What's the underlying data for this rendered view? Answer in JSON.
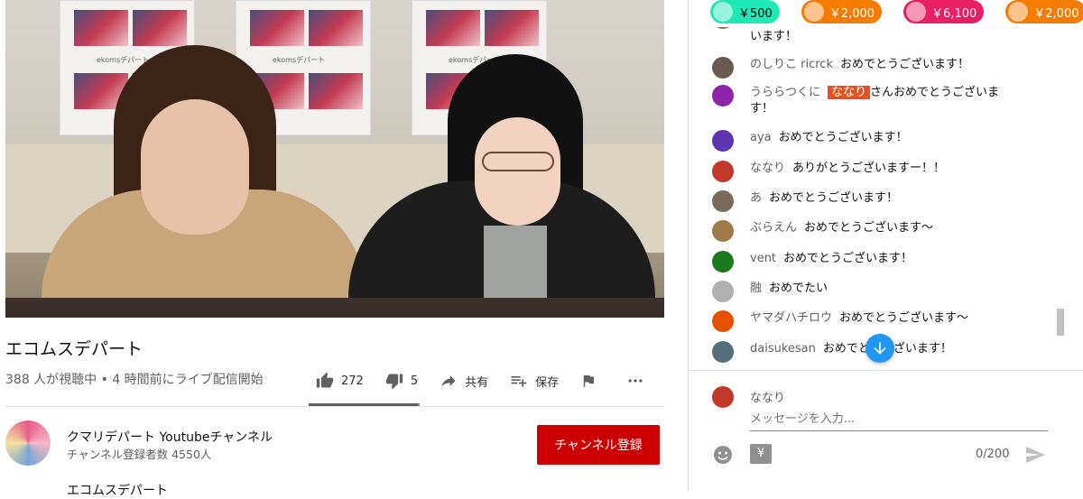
{
  "video": {
    "title": "エコムスデパート",
    "meta": "388 人が視聴中 • 4 時間前にライブ配信開始",
    "poster_brand": "ekomsデパート",
    "actions": {
      "likes": "272",
      "dislikes": "5",
      "share": "共有",
      "save": "保存"
    },
    "like_ratio": 0.98
  },
  "channel": {
    "name": "クマリデパート Youtubeチャンネル",
    "subscribers": "チャンネル登録者数 4550人",
    "subscribe_label": "チャンネル登録",
    "description_start": "エコムスデパート"
  },
  "chat": {
    "tickers": [
      {
        "amount": "￥500",
        "color": "#1de9b6",
        "text_color": "#000000"
      },
      {
        "amount": "￥2,000",
        "color": "#f57c00",
        "text_color": "#ffffff"
      },
      {
        "amount": "￥6,100",
        "color": "#e91e63",
        "text_color": "#ffffff"
      },
      {
        "amount": "￥2,000",
        "color": "#f57c00",
        "text_color": "#ffffff"
      }
    ],
    "messages": [
      {
        "author": "",
        "text": "います！",
        "avatar_color": "#8e6b5b"
      },
      {
        "author": "のしりこ ricrck",
        "text": "おめでとうございます！",
        "avatar_color": "#6b5a4e"
      },
      {
        "author": "うららつくに",
        "mention": "ななり",
        "text": "さんおめでとうございます！",
        "avatar_color": "#8e24aa"
      },
      {
        "author": "aya",
        "text": "おめでとうございます！",
        "avatar_color": "#5e35b1"
      },
      {
        "author": "ななり",
        "text": "ありがとうございますー！！",
        "avatar_color": "#c0392b"
      },
      {
        "author": "あ",
        "text": "おめでとうございます！",
        "avatar_color": "#7a6a5a"
      },
      {
        "author": "ぶらえん",
        "text": "おめでとうございます〜",
        "avatar_color": "#a07a4a"
      },
      {
        "author": "vent",
        "text": "おめでとうございます！",
        "avatar_color": "#1b7a1b"
      },
      {
        "author": "融",
        "text": "おめでたい",
        "avatar_color": "#b0b0b0"
      },
      {
        "author": "ヤマダハチロウ",
        "text": "おめでとうございます〜",
        "avatar_color": "#e65100"
      },
      {
        "author": "daisukesan",
        "text": "おめでとうございます！",
        "avatar_color": "#546e7a"
      }
    ],
    "composer": {
      "author": "ななり",
      "placeholder": "メッセージを入力...",
      "counter": "0/200",
      "yen": "¥"
    }
  }
}
